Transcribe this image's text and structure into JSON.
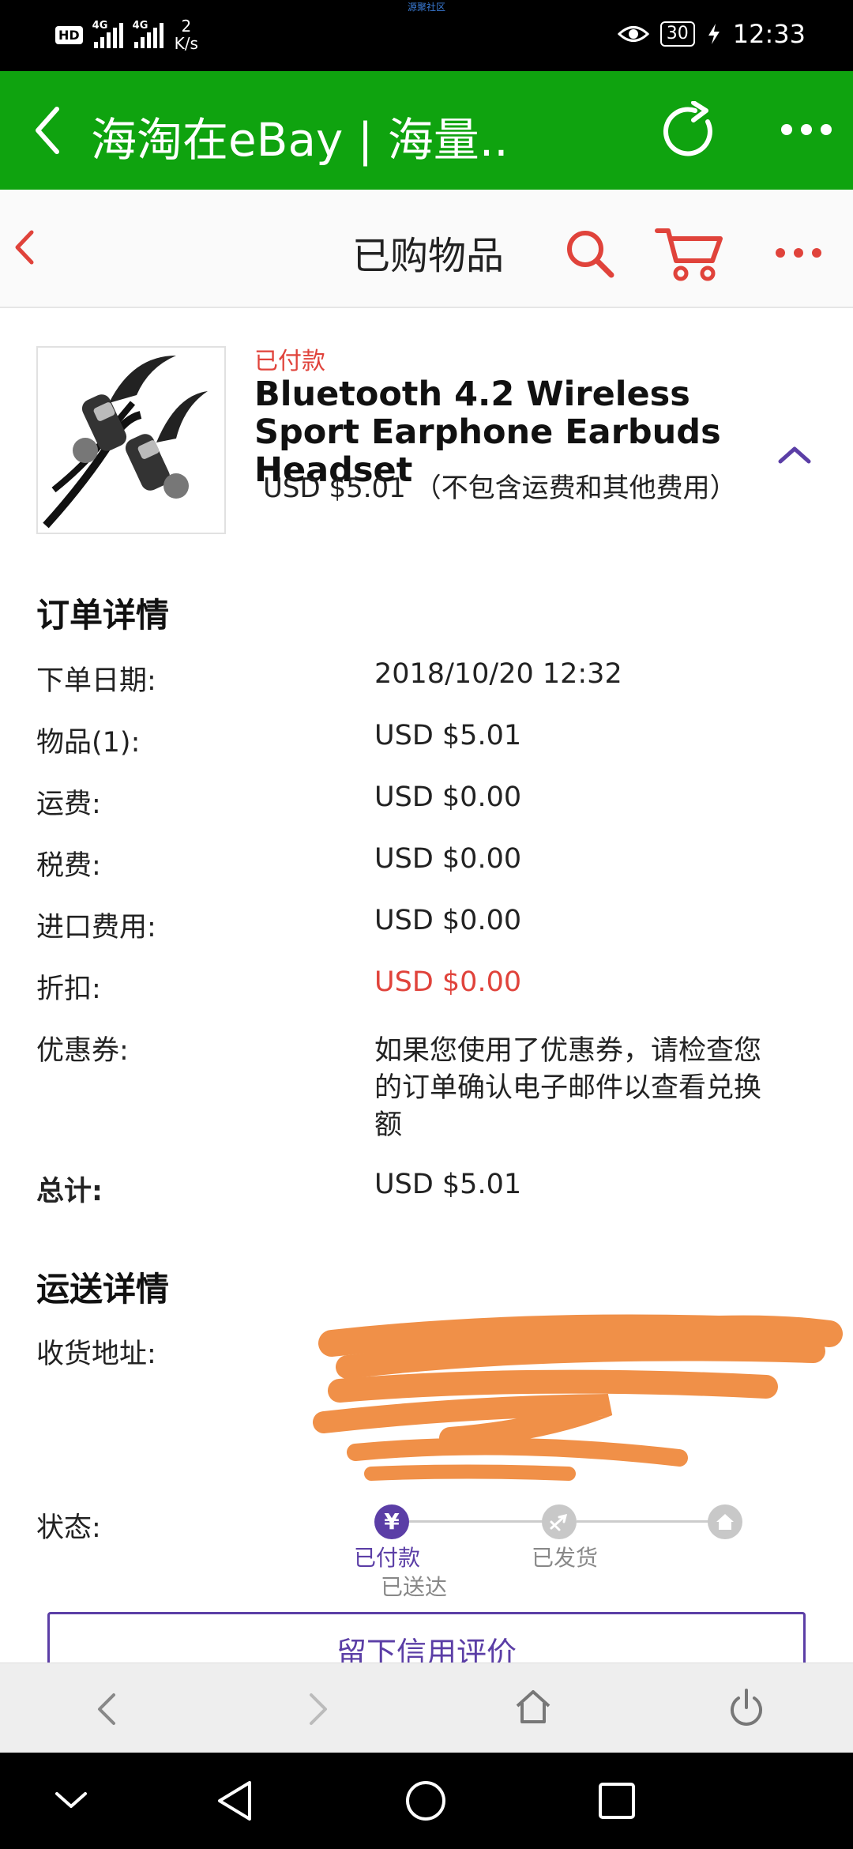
{
  "statusbar": {
    "top_tiny_text": "源聚社区",
    "hd": "HD",
    "net1": "4G",
    "net2": "4G",
    "speed_value": "2",
    "speed_unit": "K/s",
    "battery": "30",
    "time": "12:33"
  },
  "browser": {
    "title": "海淘在eBay | 海量.."
  },
  "ebay_header": {
    "title": "已购物品"
  },
  "product": {
    "status": "已付款",
    "title": "Bluetooth 4.2 Wireless Sport Earphone Earbuds Headset",
    "price": "USD $5.01 （不包含运费和其他费用）"
  },
  "order_details": {
    "title": "订单详情",
    "rows": [
      {
        "label": "下单日期:",
        "value": "2018/10/20 12:32"
      },
      {
        "label": "物品(1):",
        "value": "USD $5.01"
      },
      {
        "label": "运费:",
        "value": "USD $0.00"
      },
      {
        "label": "税费:",
        "value": "USD $0.00"
      },
      {
        "label": "进口费用:",
        "value": "USD $0.00"
      },
      {
        "label": "折扣:",
        "value": "USD $0.00"
      },
      {
        "label": "优惠券:",
        "value_lines": [
          "如果您使用了优惠券，请检查您",
          "的订单确认电子邮件以查看兑换",
          "额"
        ]
      },
      {
        "label": "总计:",
        "value": "USD $5.01"
      }
    ]
  },
  "shipping": {
    "title": "运送详情",
    "address_label": "收货地址:",
    "status_label": "状态:",
    "steps": [
      {
        "label": "已付款",
        "icon": "yen-icon"
      },
      {
        "label": "已发货",
        "icon": "plane-icon"
      },
      {
        "label": "已送达",
        "icon": "home-icon"
      }
    ]
  },
  "feedback_button": "留下信用评价",
  "colors": {
    "green": "#0fa30f",
    "ebay_red": "#e0433b",
    "purple": "#5b3ea6"
  }
}
